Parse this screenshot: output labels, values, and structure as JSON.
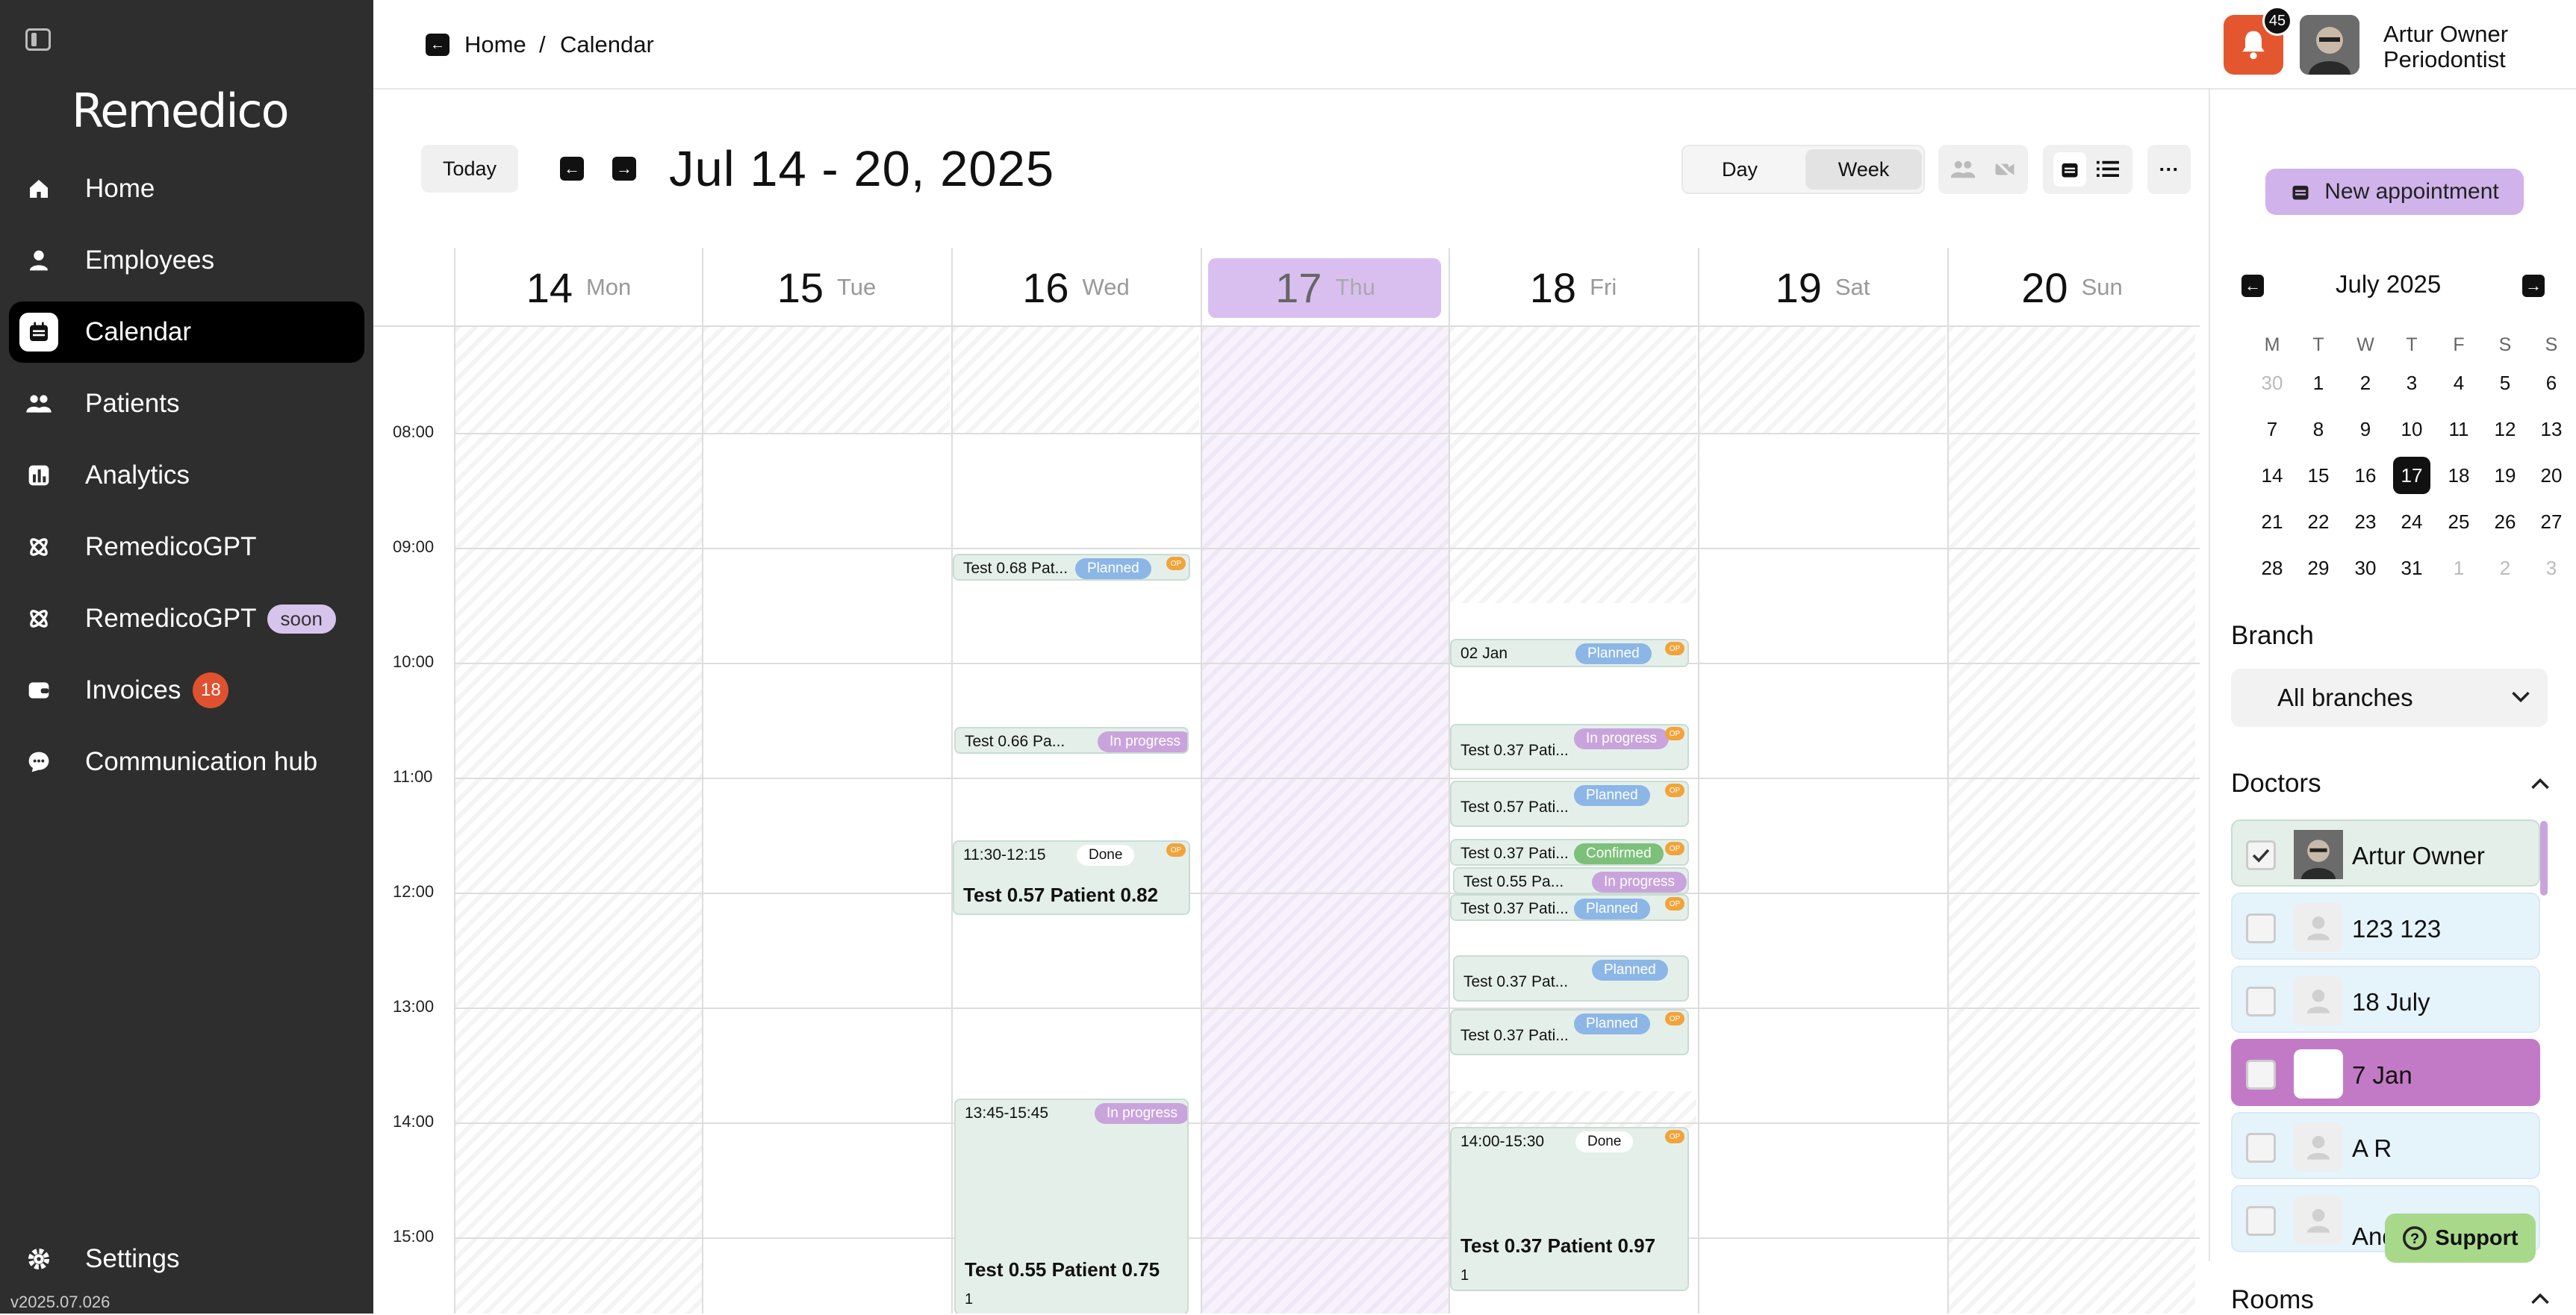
{
  "app": {
    "version": "v2025.07.026",
    "logo": "Remedico"
  },
  "sidebar": {
    "items": [
      {
        "label": "Home",
        "icon": "home-icon"
      },
      {
        "label": "Employees",
        "icon": "person-icon"
      },
      {
        "label": "Calendar",
        "icon": "calendar-icon",
        "active": true
      },
      {
        "label": "Patients",
        "icon": "people-icon"
      },
      {
        "label": "Analytics",
        "icon": "chart-icon"
      },
      {
        "label": "RemedicoGPT",
        "icon": "atom-icon"
      },
      {
        "label": "RemedicoGPT",
        "icon": "atom-icon",
        "pill": "soon"
      },
      {
        "label": "Invoices",
        "icon": "wallet-icon",
        "count": "18"
      },
      {
        "label": "Communication hub",
        "icon": "chat-icon"
      }
    ],
    "settings": "Settings"
  },
  "header": {
    "breadcrumb": [
      "Home",
      "Calendar"
    ],
    "breadcrumb_sep": "/",
    "notifications": "45",
    "user": {
      "name": "Artur Owner",
      "role": "Periodontist"
    }
  },
  "toolbar": {
    "today": "Today",
    "range": "Jul 14 - 20, 2025",
    "views": [
      "Day",
      "Week"
    ],
    "active_view": "Week",
    "more": "···",
    "new_appointment": "New appointment"
  },
  "calendar": {
    "days": [
      {
        "num": "14",
        "name": "Mon"
      },
      {
        "num": "15",
        "name": "Tue"
      },
      {
        "num": "16",
        "name": "Wed"
      },
      {
        "num": "17",
        "name": "Thu",
        "today": true
      },
      {
        "num": "18",
        "name": "Fri"
      },
      {
        "num": "19",
        "name": "Sat"
      },
      {
        "num": "20",
        "name": "Sun"
      }
    ],
    "times": [
      "08:00",
      "09:00",
      "10:00",
      "11:00",
      "12:00",
      "13:00",
      "14:00",
      "15:00"
    ],
    "events": [
      {
        "day": 2,
        "title": "Test 0.68 Pat...",
        "badge": "Planned",
        "status": "planned",
        "op": "OP"
      },
      {
        "day": 2,
        "title": "Test 0.66 Pa...",
        "badge": "In progress",
        "status": "prog"
      },
      {
        "day": 2,
        "title": "11:30-12:15",
        "badge": "Done",
        "status": "done",
        "op": "OP",
        "big": "Test 0.57 Patient 0.82"
      },
      {
        "day": 2,
        "title": "13:45-15:45",
        "badge": "In progress",
        "status": "prog",
        "big": "Test 0.55 Patient 0.75",
        "extra": "1"
      },
      {
        "day": 4,
        "title": "02 Jan",
        "badge": "Planned",
        "status": "planned",
        "op": "OP"
      },
      {
        "day": 4,
        "title": "Test 0.37 Pati...",
        "badge": "In progress",
        "status": "prog",
        "op": "OP"
      },
      {
        "day": 4,
        "title": "Test 0.57 Pati...",
        "badge": "Planned",
        "status": "planned",
        "op": "OP"
      },
      {
        "day": 4,
        "title": "Test 0.37 Pati...",
        "badge": "Confirmed",
        "status": "conf",
        "op": "OP"
      },
      {
        "day": 4,
        "title": "Test 0.55 Pa...",
        "badge": "In progress",
        "status": "prog"
      },
      {
        "day": 4,
        "title": "Test 0.37 Pati...",
        "badge": "Planned",
        "status": "planned",
        "op": "OP"
      },
      {
        "day": 4,
        "title": "Test 0.37 Pat...",
        "badge": "Planned",
        "status": "planned"
      },
      {
        "day": 4,
        "title": "Test 0.37 Pati...",
        "badge": "Planned",
        "status": "planned",
        "op": "OP"
      },
      {
        "day": 4,
        "title": "14:00-15:30",
        "badge": "Done",
        "status": "done",
        "op": "OP",
        "big": "Test 0.37 Patient 0.97",
        "extra": "1"
      }
    ]
  },
  "minical": {
    "title": "July 2025",
    "dow": [
      "M",
      "T",
      "W",
      "T",
      "F",
      "S",
      "S"
    ],
    "weeks": [
      [
        "30",
        "1",
        "2",
        "3",
        "4",
        "5",
        "6"
      ],
      [
        "7",
        "8",
        "9",
        "10",
        "11",
        "12",
        "13"
      ],
      [
        "14",
        "15",
        "16",
        "17",
        "18",
        "19",
        "20"
      ],
      [
        "21",
        "22",
        "23",
        "24",
        "25",
        "26",
        "27"
      ],
      [
        "28",
        "29",
        "30",
        "31",
        "1",
        "2",
        "3"
      ]
    ],
    "selected": "17"
  },
  "filters": {
    "branch_label": "Branch",
    "branch_value": "All branches",
    "doctors_label": "Doctors",
    "doctors": [
      {
        "name": "Artur Owner",
        "checked": true
      },
      {
        "name": "123 123",
        "checked": false
      },
      {
        "name": "18 July",
        "checked": false
      },
      {
        "name": "7 Jan",
        "checked": false,
        "highlight": true
      },
      {
        "name": "A R",
        "checked": false
      },
      {
        "name": "Andrii P",
        "checked": false
      }
    ],
    "rooms_label": "Rooms"
  },
  "support": "Support"
}
